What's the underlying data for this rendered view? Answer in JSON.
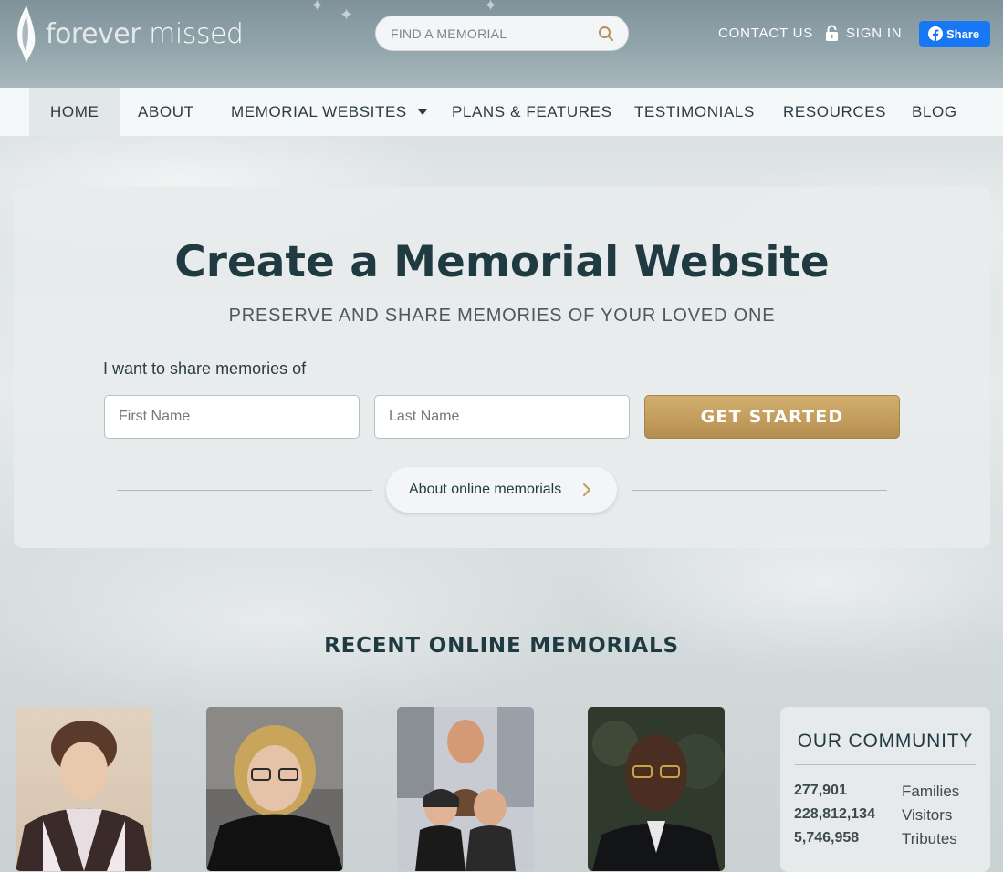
{
  "brand": {
    "name_light": "forever",
    "name_main": "missed"
  },
  "search": {
    "placeholder": "FIND A MEMORIAL"
  },
  "header_links": {
    "contact": "CONTACT US",
    "signin": "SIGN IN",
    "share": "Share"
  },
  "nav": {
    "home": "HOME",
    "about": "ABOUT",
    "memorial_websites": "MEMORIAL WEBSITES",
    "plans": "PLANS & FEATURES",
    "testimonials": "TESTIMONIALS",
    "resources": "RESOURCES",
    "blog": "BLOG"
  },
  "hero": {
    "title": "Create a Memorial Website",
    "subtitle": "PRESERVE AND SHARE MEMORIES OF YOUR LOVED ONE",
    "label": "I want to share memories of",
    "first_name_placeholder": "First Name",
    "last_name_placeholder": "Last Name",
    "cta": "GET STARTED",
    "about_link": "About online memorials"
  },
  "recent": {
    "title": "RECENT ONLINE MEMORIALS"
  },
  "community": {
    "title": "OUR COMMUNITY",
    "stats": [
      {
        "value": "277,901",
        "label": "Families"
      },
      {
        "value": "228,812,134",
        "label": "Visitors"
      },
      {
        "value": "5,746,958",
        "label": "Tributes"
      }
    ]
  },
  "colors": {
    "accent_gold": "#c19c5d",
    "text_dark": "#1f3a40",
    "facebook": "#1877f2"
  }
}
